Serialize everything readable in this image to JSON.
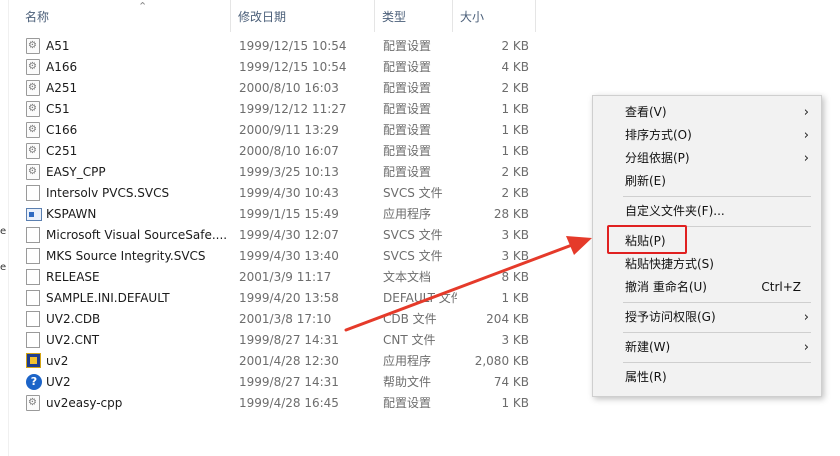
{
  "columns": {
    "name": "名称",
    "date": "修改日期",
    "type": "类型",
    "size": "大小"
  },
  "files": [
    {
      "name": "A51",
      "date": "1999/12/15 10:54",
      "type": "配置设置",
      "size": "2 KB",
      "icon": "config-file-icon"
    },
    {
      "name": "A166",
      "date": "1999/12/15 10:54",
      "type": "配置设置",
      "size": "4 KB",
      "icon": "config-file-icon"
    },
    {
      "name": "A251",
      "date": "2000/8/10 16:03",
      "type": "配置设置",
      "size": "2 KB",
      "icon": "config-file-icon"
    },
    {
      "name": "C51",
      "date": "1999/12/12 11:27",
      "type": "配置设置",
      "size": "1 KB",
      "icon": "config-file-icon"
    },
    {
      "name": "C166",
      "date": "2000/9/11 13:29",
      "type": "配置设置",
      "size": "1 KB",
      "icon": "config-file-icon"
    },
    {
      "name": "C251",
      "date": "2000/8/10 16:07",
      "type": "配置设置",
      "size": "1 KB",
      "icon": "config-file-icon"
    },
    {
      "name": "EASY_CPP",
      "date": "1999/3/25 10:13",
      "type": "配置设置",
      "size": "2 KB",
      "icon": "config-file-icon"
    },
    {
      "name": "Intersolv PVCS.SVCS",
      "date": "1999/4/30 10:43",
      "type": "SVCS 文件",
      "size": "2 KB",
      "icon": "document-icon"
    },
    {
      "name": "KSPAWN",
      "date": "1999/1/15 15:49",
      "type": "应用程序",
      "size": "28 KB",
      "icon": "application-icon"
    },
    {
      "name": "Microsoft Visual SourceSafe....",
      "date": "1999/4/30 12:07",
      "type": "SVCS 文件",
      "size": "3 KB",
      "icon": "document-icon"
    },
    {
      "name": "MKS Source Integrity.SVCS",
      "date": "1999/4/30 13:40",
      "type": "SVCS 文件",
      "size": "3 KB",
      "icon": "document-icon"
    },
    {
      "name": "RELEASE",
      "date": "2001/3/9 11:17",
      "type": "文本文档",
      "size": "8 KB",
      "icon": "document-icon"
    },
    {
      "name": "SAMPLE.INI.DEFAULT",
      "date": "1999/4/20 13:58",
      "type": "DEFAULT 文件",
      "size": "1 KB",
      "icon": "document-icon"
    },
    {
      "name": "UV2.CDB",
      "date": "2001/3/8 17:10",
      "type": "CDB 文件",
      "size": "204 KB",
      "icon": "document-icon"
    },
    {
      "name": "UV2.CNT",
      "date": "1999/8/27 14:31",
      "type": "CNT 文件",
      "size": "3 KB",
      "icon": "document-icon"
    },
    {
      "name": "uv2",
      "date": "2001/4/28 12:30",
      "type": "应用程序",
      "size": "2,080 KB",
      "icon": "uv2-app-icon"
    },
    {
      "name": "UV2",
      "date": "1999/8/27 14:31",
      "type": "帮助文件",
      "size": "74 KB",
      "icon": "help-file-icon"
    },
    {
      "name": "uv2easy-cpp",
      "date": "1999/4/28 16:45",
      "type": "配置设置",
      "size": "1 KB",
      "icon": "config-file-icon"
    }
  ],
  "context_menu": {
    "view": "查看(V)",
    "sort_by": "排序方式(O)",
    "group_by": "分组依据(P)",
    "refresh": "刷新(E)",
    "customize_folder": "自定义文件夹(F)...",
    "paste": "粘贴(P)",
    "paste_shortcut": "粘贴快捷方式(S)",
    "undo_rename": "撤消 重命名(U)",
    "undo_shortcut": "Ctrl+Z",
    "give_access": "授予访问权限(G)",
    "new": "新建(W)",
    "properties": "属性(R)"
  },
  "left_strip": {
    "a": "e",
    "b": "e"
  },
  "colors": {
    "highlight": "#e02020",
    "arrow": "#e53a2a",
    "menu_bg": "#f2f2f2"
  }
}
